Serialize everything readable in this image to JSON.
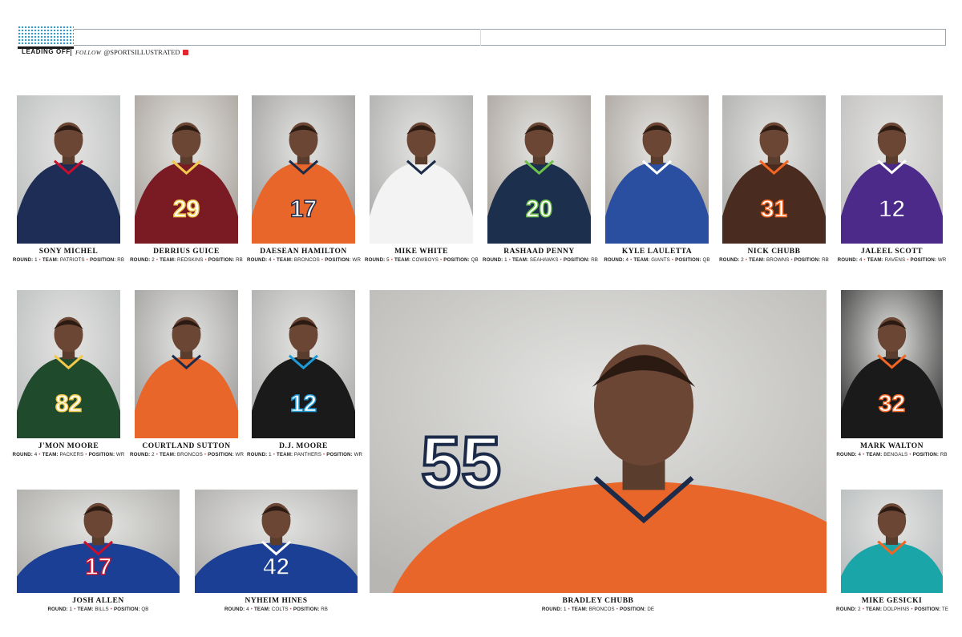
{
  "header": {
    "section": "LEADING OFF",
    "follow_word": "FOLLOW",
    "handle": "@SPORTSILLUSTRATED"
  },
  "labels": {
    "round": "ROUND:",
    "team": "TEAM:",
    "position": "POSITION:"
  },
  "players": [
    {
      "name": "SONY MICHEL",
      "round": "1",
      "team": "PATRIOTS",
      "position": "RB",
      "jersey": "",
      "color": "#1e2d55",
      "accent": "#c8102e",
      "bg": "#b9bcbd"
    },
    {
      "name": "DERRIUS GUICE",
      "round": "2",
      "team": "REDSKINS",
      "position": "RB",
      "jersey": "29",
      "color": "#7a1b24",
      "accent": "#f2c94c",
      "bg": "#a59e97"
    },
    {
      "name": "DAESEAN HAMILTON",
      "round": "4",
      "team": "BRONCOS",
      "position": "WR",
      "jersey": "17",
      "color": "#e8662a",
      "accent": "#1c2b4a",
      "bg": "#9b9a98"
    },
    {
      "name": "MIKE WHITE",
      "round": "5",
      "team": "COWBOYS",
      "position": "QB",
      "jersey": "",
      "color": "#f3f3f3",
      "accent": "#1c2b4a",
      "bg": "#a9aaa8"
    },
    {
      "name": "RASHAAD PENNY",
      "round": "1",
      "team": "SEAHAWKS",
      "position": "RB",
      "jersey": "20",
      "color": "#1c2f4d",
      "accent": "#6cc24a",
      "bg": "#a8a6a2"
    },
    {
      "name": "KYLE LAULETTA",
      "round": "4",
      "team": "GIANTS",
      "position": "QB",
      "jersey": "",
      "color": "#2a4ea0",
      "accent": "#ffffff",
      "bg": "#3c3c3c"
    },
    {
      "name": "NICK CHUBB",
      "round": "2",
      "team": "BROWNS",
      "position": "RB",
      "jersey": "31",
      "color": "#4a2b1f",
      "accent": "#f26522",
      "bg": "#a3a19d"
    },
    {
      "name": "JALEEL SCOTT",
      "round": "4",
      "team": "RAVENS",
      "position": "WR",
      "jersey": "12",
      "color": "#4b2a8a",
      "accent": "#ffffff",
      "bg": "#bdbcbb"
    },
    {
      "name": "J'MON MOORE",
      "round": "4",
      "team": "PACKERS",
      "position": "WR",
      "jersey": "82",
      "color": "#1f4a2c",
      "accent": "#f2c94c",
      "bg": "#a29f9a"
    },
    {
      "name": "COURTLAND SUTTON",
      "round": "2",
      "team": "BRONCOS",
      "position": "WR",
      "jersey": "",
      "color": "#e8662a",
      "accent": "#1c2b4a",
      "bg": "#a19d98"
    },
    {
      "name": "D.J. MOORE",
      "round": "1",
      "team": "PANTHERS",
      "position": "WR",
      "jersey": "12",
      "color": "#1a1a1a",
      "accent": "#1e9bd7",
      "bg": "#9e9a95"
    },
    {
      "name": "BRADLEY CHUBB",
      "round": "1",
      "team": "BRONCOS",
      "position": "DE",
      "jersey": "55",
      "color": "#e8662a",
      "accent": "#1c2b4a",
      "bg": "#b7b6b3"
    },
    {
      "name": "MARK WALTON",
      "round": "4",
      "team": "BENGALS",
      "position": "RB",
      "jersey": "32",
      "color": "#1a1a1a",
      "accent": "#f26522",
      "bg": "#2c2c2c"
    },
    {
      "name": "JOSH ALLEN",
      "round": "1",
      "team": "BILLS",
      "position": "QB",
      "jersey": "17",
      "color": "#1b3f94",
      "accent": "#c8102e",
      "bg": "#a7a6a3"
    },
    {
      "name": "NYHEIM HINES",
      "round": "4",
      "team": "COLTS",
      "position": "RB",
      "jersey": "42",
      "color": "#1b3f94",
      "accent": "#ffffff",
      "bg": "#a9a8a6"
    },
    {
      "name": "MIKE GESICKI",
      "round": "2",
      "team": "DOLPHINS",
      "position": "TE",
      "jersey": "",
      "color": "#1aa5a8",
      "accent": "#f26522",
      "bg": "#b5b9bb"
    }
  ]
}
